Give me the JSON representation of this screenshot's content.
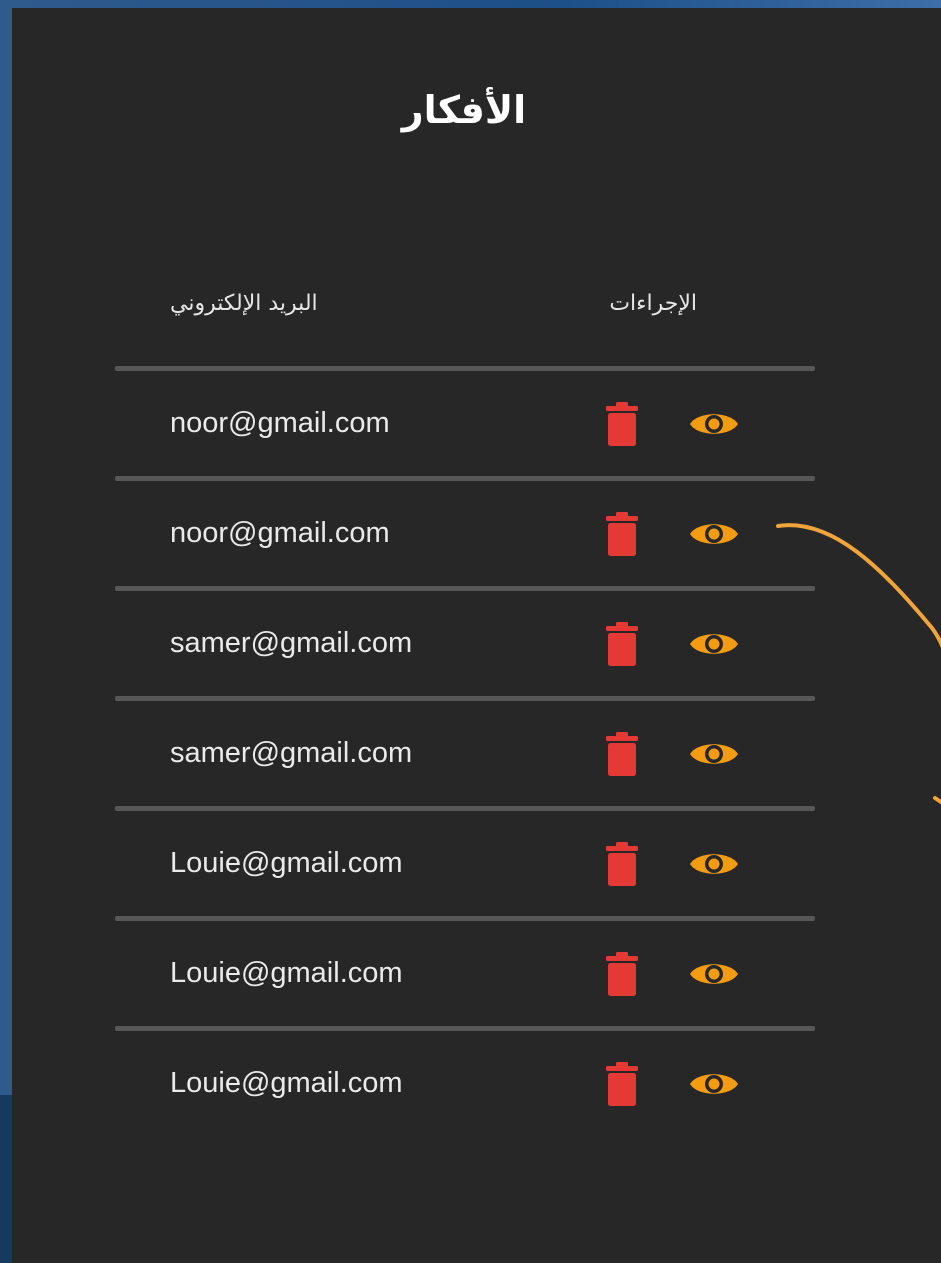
{
  "panel": {
    "title": "الأفكار"
  },
  "table": {
    "columns": {
      "email": "البريد الإلكتروني",
      "actions": "الإجراءات"
    },
    "rows": [
      {
        "email": "noor@gmail.com"
      },
      {
        "email": "noor@gmail.com"
      },
      {
        "email": "samer@gmail.com"
      },
      {
        "email": "samer@gmail.com"
      },
      {
        "email": "Louie@gmail.com"
      },
      {
        "email": "Louie@gmail.com"
      },
      {
        "email": "Louie@gmail.com"
      }
    ],
    "row_actions": {
      "delete_icon": "trash-icon",
      "view_icon": "eye-icon"
    }
  },
  "colors": {
    "panel_bg": "#272727",
    "page_bg": "#2f5a8c",
    "divider": "#575757",
    "delete_accent": "#e53935",
    "view_accent": "#f39c12",
    "arrow_accent": "#f0a43a"
  }
}
